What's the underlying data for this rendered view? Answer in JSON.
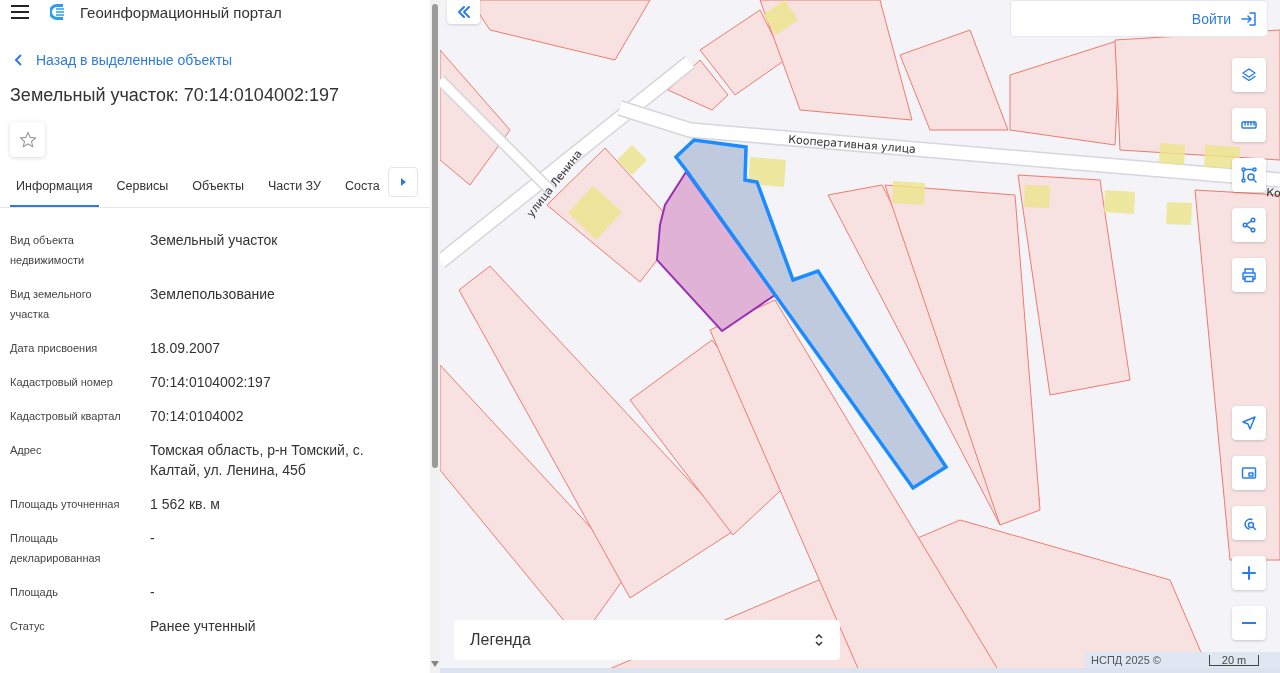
{
  "header": {
    "title": "Геоинформационный портал"
  },
  "back_link": "Назад в выделенные объекты",
  "object_title": "Земельный участок: 70:14:0104002:197",
  "tabs": [
    {
      "label": "Информация",
      "selected": true
    },
    {
      "label": "Сервисы",
      "selected": false
    },
    {
      "label": "Объекты",
      "selected": false
    },
    {
      "label": "Части ЗУ",
      "selected": false
    },
    {
      "label": "Соста",
      "selected": false
    }
  ],
  "attributes": [
    {
      "label": "Вид объекта недвижимости",
      "value": "Земельный участок"
    },
    {
      "label": "Вид земельного участка",
      "value": "Землепользование"
    },
    {
      "label": "Дата присвоения",
      "value": "18.09.2007"
    },
    {
      "label": "Кадастровый номер",
      "value": "70:14:0104002:197"
    },
    {
      "label": "Кадастровый квартал",
      "value": "70:14:0104002"
    },
    {
      "label": "Адрес",
      "value": "Томская область, р-н Томский, с. Калтай, ул. Ленина, 45б"
    },
    {
      "label": "Площадь уточненная",
      "value": "1 562 кв. м"
    },
    {
      "label": "Площадь декларированная",
      "value": "-"
    },
    {
      "label": "Площадь",
      "value": "-"
    },
    {
      "label": "Статус",
      "value": "Ранее учтенный"
    }
  ],
  "map": {
    "street_labels": [
      {
        "text": "улица Ленина",
        "kind": "lenina"
      },
      {
        "text": "Кооперативная улица",
        "kind": "cooperative"
      },
      {
        "text": "Ко",
        "kind": "edge"
      }
    ],
    "login_button": "Войти",
    "legend": "Легенда",
    "attribution": "НСПД 2025 ©",
    "scale": "20 m"
  }
}
